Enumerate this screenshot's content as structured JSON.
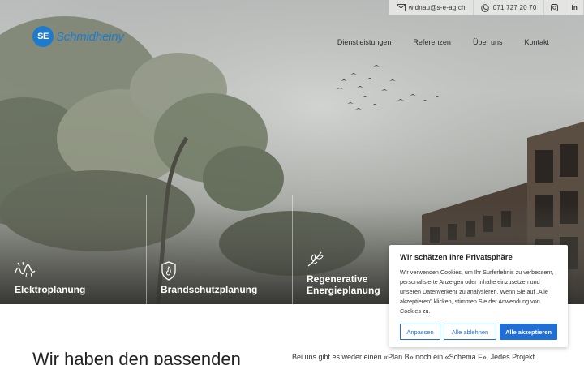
{
  "topbar": {
    "email": "widnau@s-e-ag.ch",
    "phone": "071 727 20 70",
    "instagram_icon": "instagram-icon",
    "linkedin_label": "in"
  },
  "logo": {
    "mark": "SE",
    "name": "Schmidheiny"
  },
  "nav": {
    "items": [
      "Dienstleistungen",
      "Referenzen",
      "Über uns",
      "Kontakt"
    ]
  },
  "services": [
    {
      "title": "Elektroplanung",
      "icon": "electric-wave-icon"
    },
    {
      "title": "Brandschutzplanung",
      "icon": "fire-shield-icon"
    },
    {
      "title_line1": "Regenerative",
      "title_line2": "Energieplanung",
      "icon": "leaf-branch-icon"
    }
  ],
  "content": {
    "headline": "Wir haben den passenden",
    "intro": "Bei uns gibt es weder einen «Plan B» noch ein «Schema F». Jedes Projekt"
  },
  "cookie": {
    "title": "Wir schätzen Ihre Privatsphäre",
    "text": "Wir verwenden Cookies, um Ihr Surferlebnis zu verbessern, personalisierte Anzeigen oder Inhalte einzusetzen und unseren Datenverkehr zu analysieren. Wenn Sie auf „Alle akzeptieren\" klicken, stimmen Sie der Anwendung von Cookies zu.",
    "btn_customize": "Anpassen",
    "btn_reject": "Alle ablehnen",
    "btn_accept": "Alle akzeptieren"
  },
  "colors": {
    "brand": "#1f7bc9",
    "button": "#1f6fd6"
  }
}
